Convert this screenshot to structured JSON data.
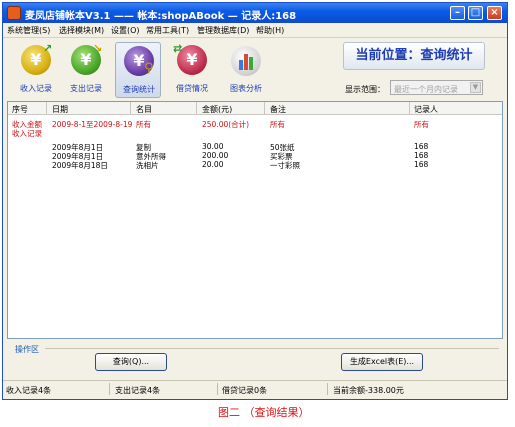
{
  "window": {
    "title": "麦凤店铺帐本V3.1 —— 帐本:shopABook — 记录人:168"
  },
  "menu": [
    "系统管理(S)",
    "选择模块(M)",
    "设置(O)",
    "常用工具(T)",
    "管理数据库(D)",
    "帮助(H)"
  ],
  "toolbar": {
    "tools": [
      {
        "label": "收入记录",
        "icon": "yen-coin-in-icon",
        "color": "#d8b214"
      },
      {
        "label": "支出记录",
        "icon": "yen-coin-out-icon",
        "color": "#4aa82a"
      },
      {
        "label": "查询统计",
        "icon": "yen-coin-search-icon",
        "color": "#6a3ea8"
      },
      {
        "label": "借贷情况",
        "icon": "yen-coin-loan-icon",
        "color": "#c23050"
      },
      {
        "label": "图表分析",
        "icon": "bar-chart-icon",
        "color": "#8a8a8a"
      }
    ],
    "location": "当前位置：查询统计",
    "scope_label": "显示范围：",
    "scope_value": "最近一个月内记录"
  },
  "grid": {
    "headers": [
      "序号",
      "日期",
      "名目",
      "金额(元)",
      "备注",
      "记录人"
    ],
    "summary": {
      "type": "收入金额",
      "date_range": "2009-8-1至2009-8-19",
      "category": "所有",
      "amount": "250.00(合计)",
      "note": "所有",
      "recorder": "所有"
    },
    "section_label": "收入记录",
    "rows": [
      {
        "date": "2009年8月1日",
        "category": "复制",
        "amount": "30.00",
        "note": "50张纸",
        "recorder": "168"
      },
      {
        "date": "2009年8月1日",
        "category": "意外所得",
        "amount": "200.00",
        "note": "买彩票",
        "recorder": "168"
      },
      {
        "date": "2009年8月18日",
        "category": "洗相片",
        "amount": "20.00",
        "note": "一寸彩照",
        "recorder": "168"
      }
    ]
  },
  "operations": {
    "label": "操作区",
    "query_button": "查询(Q)...",
    "excel_button": "生成Excel表(E)..."
  },
  "status": {
    "income": "收入记录4条",
    "expense": "支出记录4条",
    "loan": "借贷记录0条",
    "balance": "当前余额-338.00元"
  },
  "caption": "图二   （查询结果）",
  "colors": {
    "title_bar": "#0d5ce6",
    "accent_text": "#1e3cb4",
    "highlight": "#d01010"
  }
}
